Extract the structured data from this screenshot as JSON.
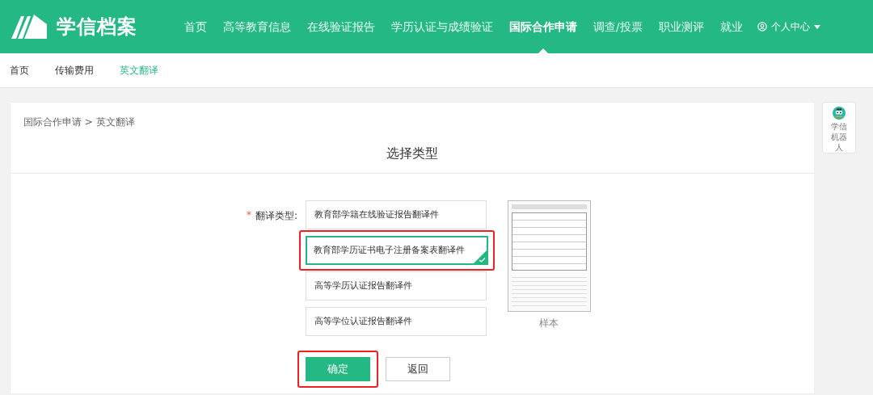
{
  "header": {
    "logo_text": "学信档案",
    "nav": [
      {
        "label": "首页",
        "selected": false
      },
      {
        "label": "高等教育信息",
        "selected": false
      },
      {
        "label": "在线验证报告",
        "selected": false
      },
      {
        "label": "学历认证与成绩验证",
        "selected": false
      },
      {
        "label": "国际合作申请",
        "selected": true
      },
      {
        "label": "调查/投票",
        "selected": false
      },
      {
        "label": "职业测评",
        "selected": false
      },
      {
        "label": "就业",
        "selected": false
      }
    ],
    "user_menu": "个人中心"
  },
  "subnav": [
    {
      "label": "首页",
      "selected": false
    },
    {
      "label": "传输费用",
      "selected": false
    },
    {
      "label": "英文翻译",
      "selected": true
    }
  ],
  "breadcrumb": "国际合作申请 > 英文翻译",
  "title": "选择类型",
  "form": {
    "required_mark": "*",
    "label": "翻译类型:",
    "options": [
      {
        "label": "教育部学籍在线验证报告翻译件",
        "selected": false,
        "annotated": false
      },
      {
        "label": "教育部学历证书电子注册备案表翻译件",
        "selected": true,
        "annotated": true
      },
      {
        "label": "高等学历认证报告翻译件",
        "selected": false,
        "annotated": false
      },
      {
        "label": "高等学位认证报告翻译件",
        "selected": false,
        "annotated": false
      }
    ],
    "sample_caption": "样本"
  },
  "buttons": [
    {
      "label": "确定",
      "kind": "primary",
      "annotated": true
    },
    {
      "label": "返回",
      "kind": "secondary",
      "annotated": false
    }
  ],
  "robot": {
    "label": "学信机器人"
  }
}
